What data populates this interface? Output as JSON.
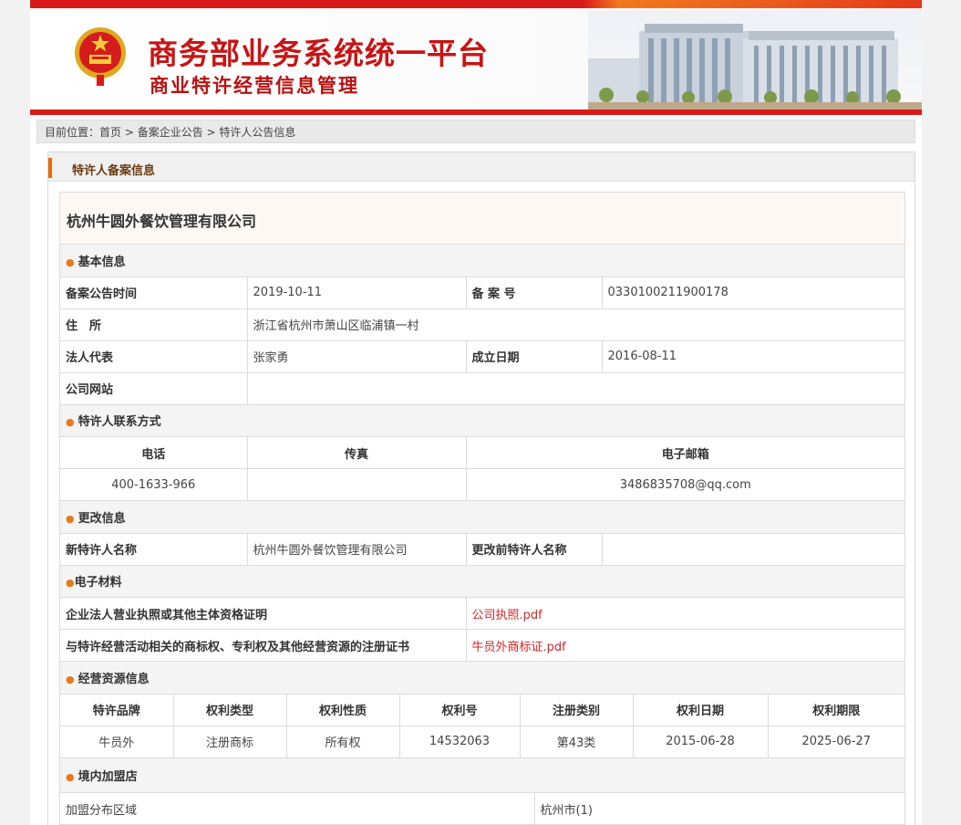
{
  "header": {
    "site_title": "商务部业务系统统一平台",
    "sub_title": "商业特许经营信息管理"
  },
  "colors": {
    "brand_red": "#d91a1a",
    "accent_orange": "#e87a1c",
    "link_red": "#d32626"
  },
  "breadcrumb": {
    "prefix": "目前位置：",
    "items": [
      "首页",
      "备案企业公告",
      "特许人公告信息"
    ],
    "separator": " > "
  },
  "panel": {
    "title": "特许人备案信息"
  },
  "company": {
    "name": "杭州牛圆外餐饮管理有限公司"
  },
  "basic": {
    "section": "基本信息",
    "announce_date_label": "备案公告时间",
    "announce_date": "2019-10-11",
    "record_no_label": "备 案 号",
    "record_no": "0330100211900178",
    "address_label": "住　所",
    "address": "浙江省杭州市萧山区临浦镇一村",
    "legal_rep_label": "法人代表",
    "legal_rep": "张家勇",
    "established_label": "成立日期",
    "established": "2016-08-11",
    "website_label": "公司网站",
    "website": ""
  },
  "contact": {
    "section": "特许人联系方式",
    "phone_label": "电话",
    "fax_label": "传真",
    "email_label": "电子邮箱",
    "phone": "400-1633-966",
    "fax": "",
    "email": "3486835708@qq.com"
  },
  "change": {
    "section": "更改信息",
    "new_name_label": "新特许人名称",
    "new_name": "杭州牛圆外餐饮管理有限公司",
    "old_name_label": "更改前特许人名称",
    "old_name": ""
  },
  "materials": {
    "section": "电子材料",
    "license_label": "企业法人营业执照或其他主体资格证明",
    "license_file": "公司执照.pdf",
    "trademark_label": "与特许经营活动相关的商标权、专利权及其他经营资源的注册证书",
    "trademark_file": "牛员外商标证.pdf"
  },
  "resources": {
    "section": "经营资源信息",
    "columns": [
      "特许品牌",
      "权利类型",
      "权利性质",
      "权利号",
      "注册类别",
      "权利日期",
      "权利期限"
    ],
    "rows": [
      [
        "牛员外",
        "注册商标",
        "所有权",
        "14532063",
        "第43类",
        "2015-06-28",
        "2025-06-27"
      ]
    ]
  },
  "stores": {
    "section": "境内加盟店",
    "region_label": "加盟分布区域",
    "region_value": "杭州市(1)"
  }
}
